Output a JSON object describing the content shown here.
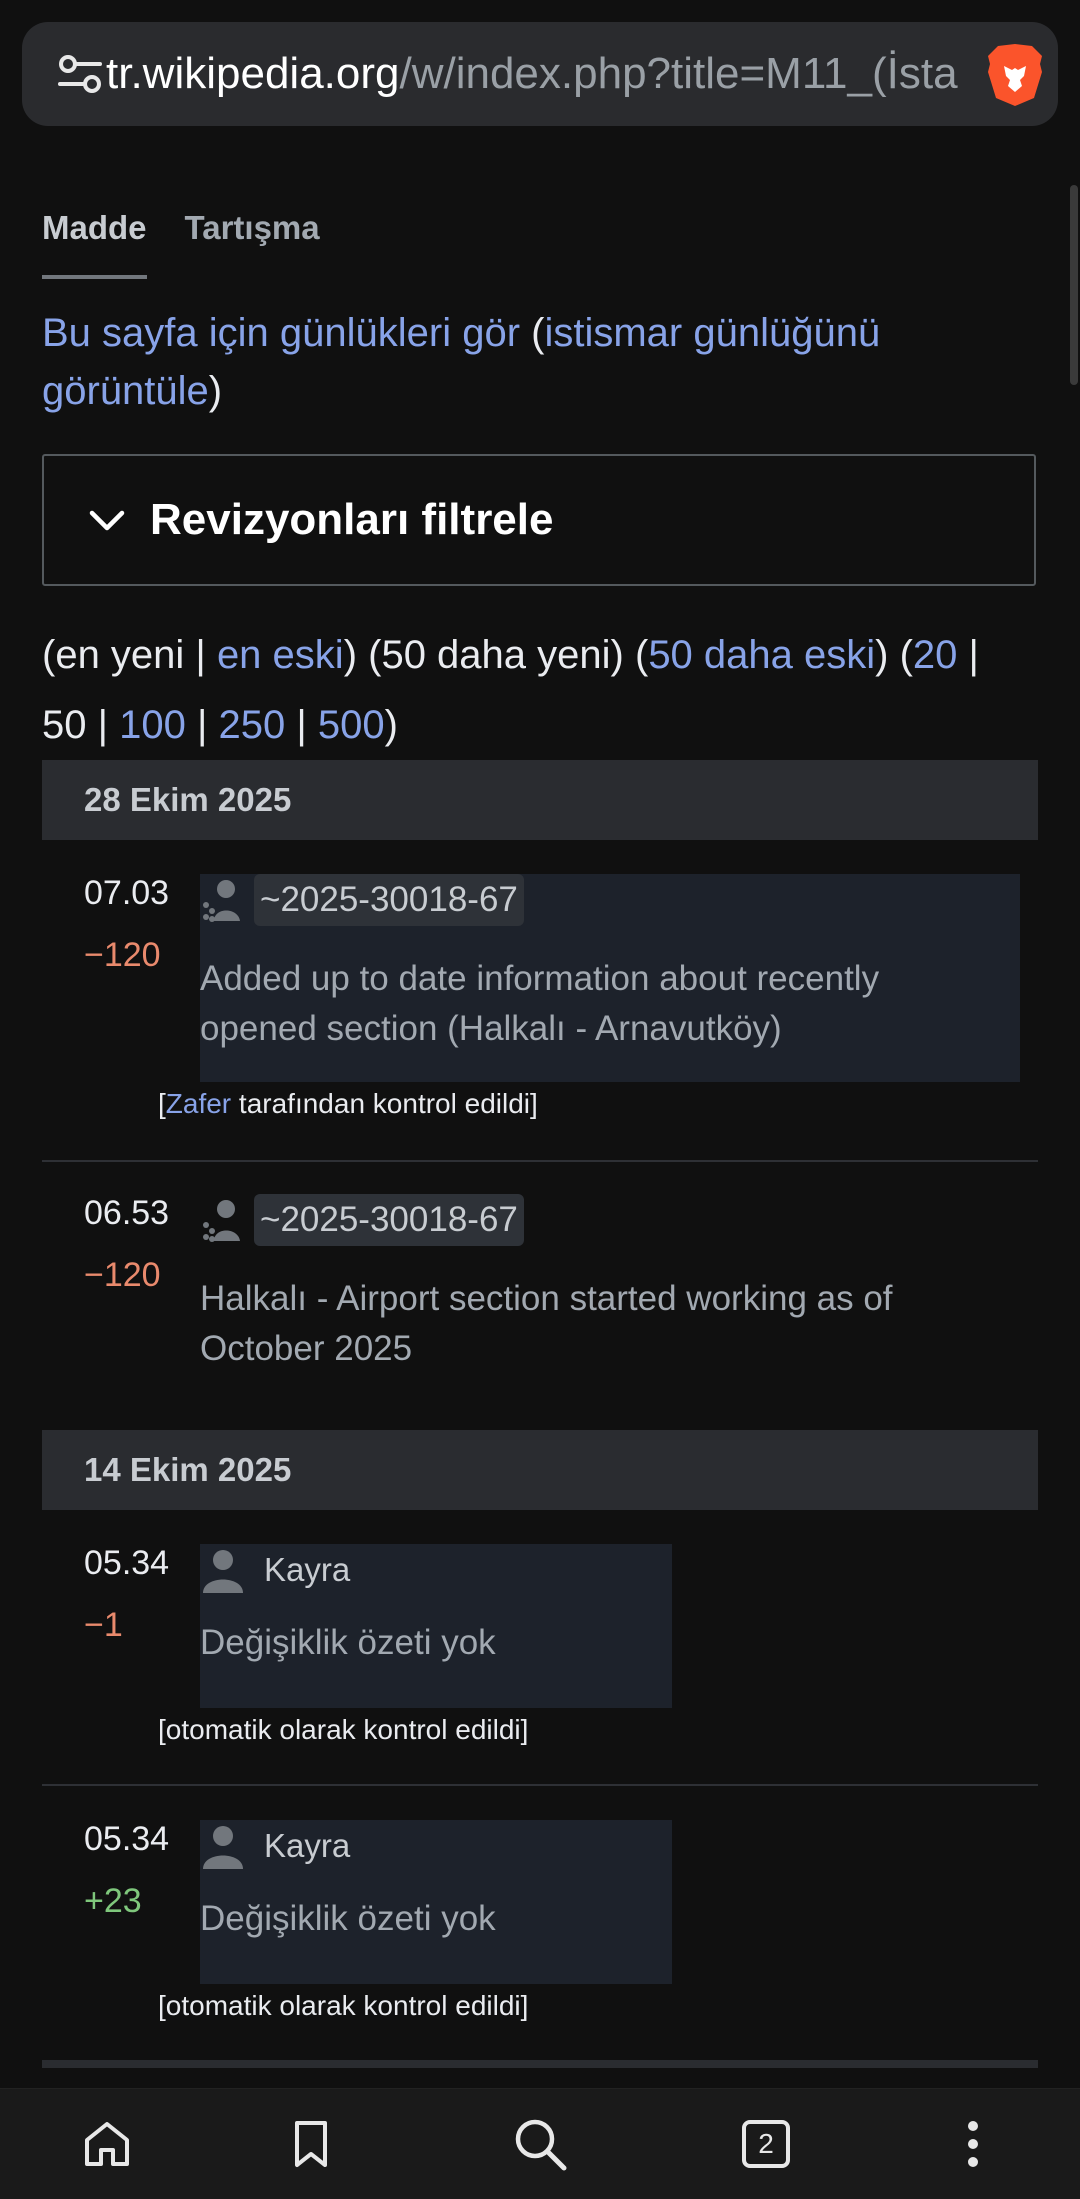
{
  "browser": {
    "url_host": "tr.wikipedia.org",
    "url_path": "/w/index.php?title=M11_(İsta",
    "tabs_count": "2"
  },
  "page": {
    "tabs": [
      {
        "label": "Madde",
        "active": true
      },
      {
        "label": "Tartışma",
        "active": false
      }
    ],
    "logs_link": "Bu sayfa için günlükleri gör",
    "abuse_log_link": "istismar günlüğünü görüntüle",
    "filter_label": "Revizyonları filtrele",
    "paging": {
      "newest": "en yeni",
      "oldest": "en eski",
      "newer50": "50 daha yeni",
      "older50": "50 daha eski",
      "limits": [
        "20",
        "50",
        "100",
        "250",
        "500"
      ]
    }
  },
  "history": [
    {
      "date": "28 Ekim 2025",
      "revisions": [
        {
          "time": "07.03",
          "size": "−120",
          "user": "~2025-30018-67",
          "summary": "Added up to date information about recently opened section (Halkalı - Arnavutköy)",
          "patrol_by": "Zafer",
          "patrol_text": "tarafından kontrol edildi"
        },
        {
          "time": "06.53",
          "size": "−120",
          "user": "~2025-30018-67",
          "summary": "Halkalı - Airport section started working as of October 2025"
        }
      ]
    },
    {
      "date": "14 Ekim 2025",
      "revisions": [
        {
          "time": "05.34",
          "size": "−1",
          "user": "Kayra",
          "summary": "Değişiklik özeti yok",
          "patrol_text": "otomatik olarak kontrol edildi"
        },
        {
          "time": "05.34",
          "size": "+23",
          "user": "Kayra",
          "summary": "Değişiklik özeti yok",
          "patrol_text": "otomatik olarak kontrol edildi"
        }
      ]
    }
  ],
  "nav": [
    "home-icon",
    "bookmark-icon",
    "search-icon",
    "tabs-icon",
    "more-icon"
  ],
  "colors": {
    "link": "#88a3e8",
    "negative": "#e98a6d",
    "positive": "#7fc77c"
  }
}
